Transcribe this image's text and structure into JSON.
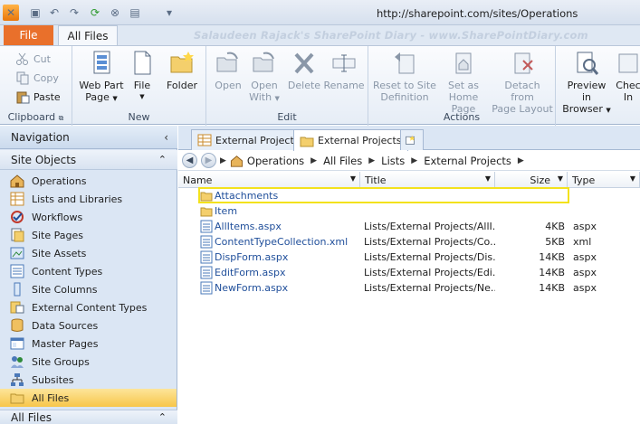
{
  "titlebar": {
    "url": "http://sharepoint.com/sites/Operations"
  },
  "tabs": {
    "file": "File",
    "all_files": "All Files"
  },
  "watermark": "Salaudeen Rajack's SharePoint Diary - www.SharePointDiary.com",
  "ribbon": {
    "clipboard": {
      "label": "Clipboard",
      "cut": "Cut",
      "copy": "Copy",
      "paste": "Paste"
    },
    "new": {
      "label": "New",
      "web_part_page_1": "Web Part",
      "web_part_page_2": "Page",
      "file": "File",
      "folder": "Folder"
    },
    "edit": {
      "label": "Edit",
      "open": "Open",
      "open_with_1": "Open",
      "open_with_2": "With",
      "delete": "Delete",
      "rename": "Rename"
    },
    "actions": {
      "label": "Actions",
      "reset_1": "Reset to Site",
      "reset_2": "Definition",
      "home_1": "Set as",
      "home_2": "Home Page",
      "detach_1": "Detach from",
      "detach_2": "Page Layout"
    },
    "preview": {
      "preview_1": "Preview in",
      "preview_2": "Browser",
      "checkin_1": "Chec",
      "checkin_2": "In"
    }
  },
  "nav": {
    "title": "Navigation",
    "site_objects": "Site Objects",
    "items": [
      {
        "label": "Operations"
      },
      {
        "label": "Lists and Libraries"
      },
      {
        "label": "Workflows"
      },
      {
        "label": "Site Pages"
      },
      {
        "label": "Site Assets"
      },
      {
        "label": "Content Types"
      },
      {
        "label": "Site Columns"
      },
      {
        "label": "External Content Types"
      },
      {
        "label": "Data Sources"
      },
      {
        "label": "Master Pages"
      },
      {
        "label": "Site Groups"
      },
      {
        "label": "Subsites"
      },
      {
        "label": "All Files"
      }
    ],
    "all_files_section": "All Files"
  },
  "doc_tabs": [
    "External Projects",
    "External Projects"
  ],
  "breadcrumb": [
    "Operations",
    "All Files",
    "Lists",
    "External Projects"
  ],
  "columns": {
    "name": "Name",
    "title": "Title",
    "size": "Size",
    "type": "Type"
  },
  "files": [
    {
      "name": "Attachments",
      "title": "",
      "size": "",
      "type": "",
      "icon": "folder-icon"
    },
    {
      "name": "Item",
      "title": "",
      "size": "",
      "type": "",
      "icon": "folder-icon"
    },
    {
      "name": "AllItems.aspx",
      "title": "Lists/External Projects/AllI...",
      "size": "4KB",
      "type": "aspx",
      "icon": "page-icon"
    },
    {
      "name": "ContentTypeCollection.xml",
      "title": "Lists/External Projects/Co...",
      "size": "5KB",
      "type": "xml",
      "icon": "page-icon"
    },
    {
      "name": "DispForm.aspx",
      "title": "Lists/External Projects/Dis...",
      "size": "14KB",
      "type": "aspx",
      "icon": "page-icon"
    },
    {
      "name": "EditForm.aspx",
      "title": "Lists/External Projects/Edi...",
      "size": "14KB",
      "type": "aspx",
      "icon": "page-icon"
    },
    {
      "name": "NewForm.aspx",
      "title": "Lists/External Projects/Ne...",
      "size": "14KB",
      "type": "aspx",
      "icon": "page-icon"
    }
  ],
  "colors": {
    "file_tab": "#e9702b",
    "selected": "#f7c64a",
    "highlight": "#f3e21c",
    "link": "#1f4e9a"
  }
}
